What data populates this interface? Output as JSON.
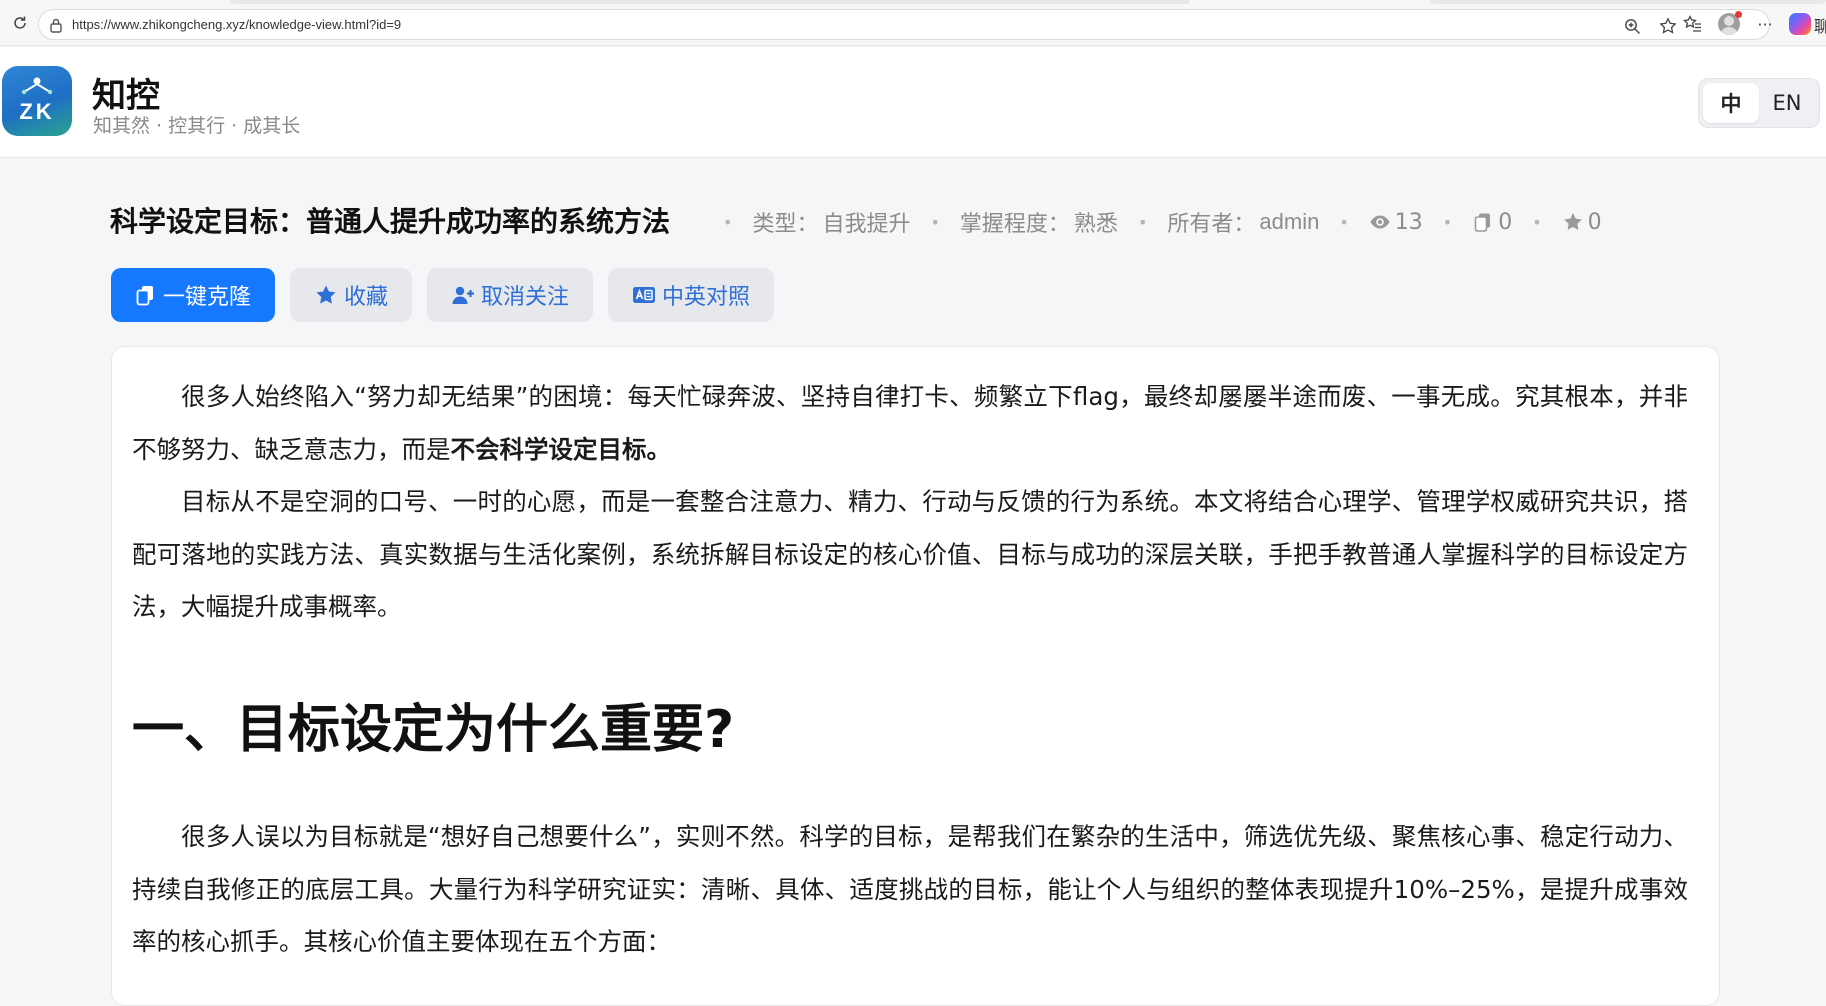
{
  "browser": {
    "url": "https://www.zhikongcheng.xyz/knowledge-view.html?id=9",
    "cut_char": "聊"
  },
  "header": {
    "logo_text": "ZK",
    "brand_name": "知控",
    "slogan": "知其然 · 控其行 · 成其长",
    "lang_options": [
      "中",
      "EN"
    ],
    "lang_active": "中"
  },
  "article": {
    "title": "科学设定目标：普通人提升成功率的系统方法",
    "meta": {
      "type_label": "类型：",
      "type_value": "自我提升",
      "mastery_label": "掌握程度：",
      "mastery_value": "熟悉",
      "owner_label": "所有者：",
      "owner_value": "admin",
      "views": "13",
      "clones": "0",
      "favorites": "0"
    },
    "actions": {
      "clone_label": "一键克隆",
      "favorite_label": "收藏",
      "unfollow_label": "取消关注",
      "bilingual_label": "中英对照"
    },
    "body": {
      "p1_text": "很多人始终陷入“努力却无结果”的困境：每天忙碌奔波、坚持自律打卡、频繁立下flag，最终却屡屡半途而废、一事无成。究其根本，并非不够努力、缺乏意志力，而是",
      "p1_bold": "不会科学设定目标。",
      "p2_text": "目标从不是空洞的口号、一时的心愿，而是一套整合注意力、精力、行动与反馈的行为系统。本文将结合心理学、管理学权威研究共识，搭配可落地的实践方法、真实数据与生活化案例，系统拆解目标设定的核心价值、目标与成功的深层关联，手把手教普通人掌握科学的目标设定方法，大幅提升成事概率。",
      "section1_heading": "一、目标设定为什么重要?",
      "p3_text": "很多人误以为目标就是“想好自己想要什么”，实则不然。科学的目标，是帮我们在繁杂的生活中，筛选优先级、聚焦核心事、稳定行动力、持续自我修正的底层工具。大量行为科学研究证实：清晰、具体、适度挑战的目标，能让个人与组织的整体表现提升10%–25%，是提升成事效率的核心抓手。其核心价值主要体现在五个方面："
    }
  },
  "colors": {
    "primary": "#1677ff",
    "button_text": "#2f6fd6",
    "meta_text": "#8c8c8c"
  }
}
